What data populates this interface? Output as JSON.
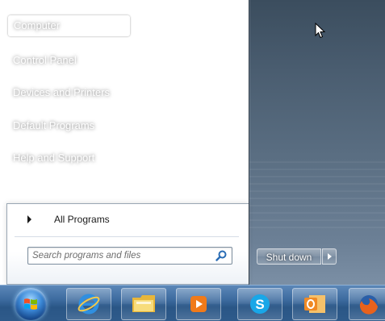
{
  "start_menu": {
    "right_pane": {
      "items": [
        {
          "label": "Computer",
          "highlighted": true
        },
        {
          "label": "Control Panel"
        },
        {
          "label": "Devices and Printers"
        },
        {
          "label": "Default Programs"
        },
        {
          "label": "Help and Support"
        }
      ],
      "shutdown_label": "Shut down"
    },
    "left_pane": {
      "all_programs_label": "All Programs",
      "search_placeholder": "Search programs and files"
    }
  },
  "taskbar": {
    "pinned": [
      {
        "icon": "internet-explorer-icon",
        "accent": "#2f8fe0"
      },
      {
        "icon": "windows-explorer-icon",
        "accent": "#f2c94c"
      },
      {
        "icon": "media-player-icon",
        "accent": "#f07a1a"
      },
      {
        "icon": "skype-icon",
        "accent": "#18a7e8"
      },
      {
        "icon": "outlook-icon",
        "accent": "#f08a24"
      },
      {
        "icon": "firefox-icon",
        "accent": "#e8621c"
      }
    ]
  },
  "colors": {
    "pane_dark": "#3b4d5e",
    "taskbar": "#2a5686",
    "text_light": "#ffffff"
  }
}
